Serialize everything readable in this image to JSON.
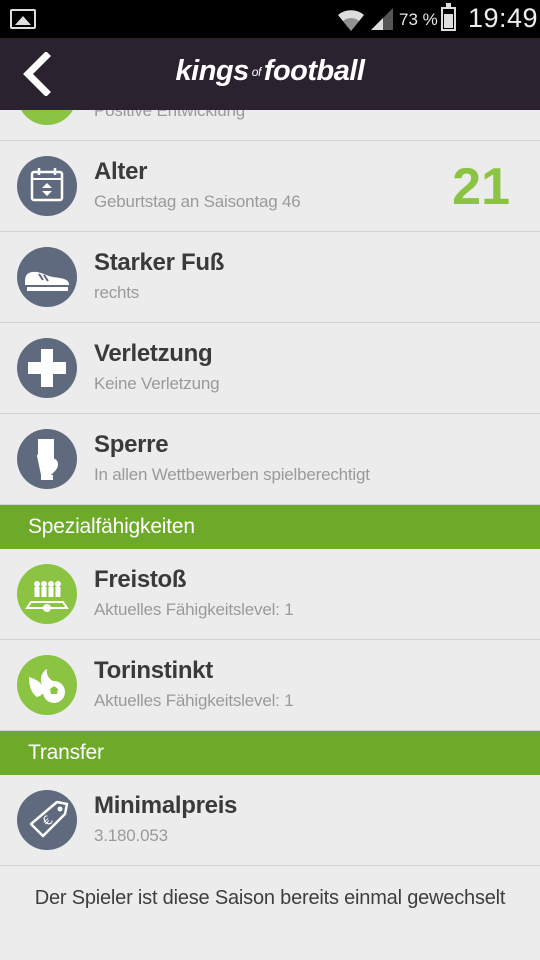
{
  "status_bar": {
    "battery_pct": "73 %",
    "time": "19:49",
    "icons": [
      "gallery-icon",
      "wifi-icon",
      "signal-icon",
      "battery-icon"
    ]
  },
  "header": {
    "logo_kings": "kings",
    "logo_of": "of",
    "logo_football": "football",
    "back_icon": "back-arrow-icon"
  },
  "rows_top": [
    {
      "icon": "trend-icon",
      "title": "",
      "subtitle": "Positive Entwicklung",
      "value": ""
    }
  ],
  "player_info": [
    {
      "icon": "calendar-icon",
      "title": "Alter",
      "subtitle": "Geburtstag an Saisontag 46",
      "value": "21"
    },
    {
      "icon": "shoe-icon",
      "title": "Starker Fuß",
      "subtitle": "rechts",
      "value": ""
    },
    {
      "icon": "medical-cross-icon",
      "title": "Verletzung",
      "subtitle": "Keine Verletzung",
      "value": ""
    },
    {
      "icon": "card-icon",
      "title": "Sperre",
      "subtitle": "In allen Wettbewerben spielberechtigt",
      "value": ""
    }
  ],
  "section_special": "Spezialfähigkeiten",
  "special_skills": [
    {
      "icon": "free-kick-icon",
      "title": "Freistoß",
      "subtitle": "Aktuelles Fähigkeitslevel: 1"
    },
    {
      "icon": "fire-ball-icon",
      "title": "Torinstinkt",
      "subtitle": "Aktuelles Fähigkeitslevel: 1"
    }
  ],
  "section_transfer": "Transfer",
  "transfer": [
    {
      "icon": "price-tag-icon",
      "title": "Minimalpreis",
      "subtitle": "3.180.053"
    }
  ],
  "footer_note": "Der Spieler ist diese Saison bereits einmal gewechselt",
  "colors": {
    "accent_green": "#8bc443",
    "section_green": "#6eaa2a",
    "header_dark": "#2b2230",
    "icon_gray": "#5f6a7e",
    "background": "#ececec"
  }
}
